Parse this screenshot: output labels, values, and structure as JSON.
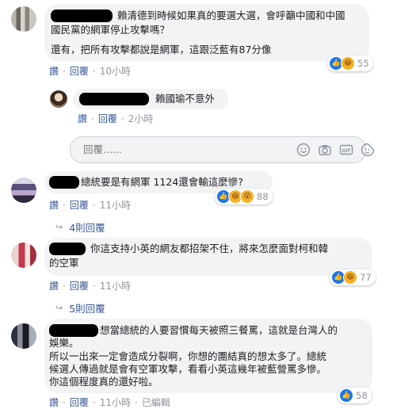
{
  "comments": [
    {
      "lines": [
        "賴清德到時候如果真的要選大選，會呼籲中國和中國",
        "國民黨的網軍停止攻擊嗎？",
        "",
        "還有，把所有攻擊都說是網軍，這跟泛藍有87分像"
      ],
      "like_label": "讚",
      "reply_label": "回覆",
      "time": "10小時",
      "reaction_count": "55"
    },
    {
      "reply_text": "賴國瑜不意外",
      "like_label": "讚",
      "reply_label": "回覆",
      "time": "2小時"
    },
    {
      "lines": [
        "總統要是有網軍 1124還會輸這麼慘?"
      ],
      "like_label": "讚",
      "reply_label": "回覆",
      "time": "11小時",
      "reaction_count": "88",
      "more_replies": "4則回覆"
    },
    {
      "lines": [
        "你這支持小英的網友都招架不住，將來怎麼面對柯和韓",
        "的空軍"
      ],
      "like_label": "讚",
      "reply_label": "回覆",
      "time": "11小時",
      "reaction_count": "77",
      "more_replies": "5則回覆"
    },
    {
      "lines": [
        "想當總統的人要習慣每天被照三餐罵，這就是台灣人的",
        "娛樂。",
        "所以一出來一定會造成分裂啊，你想的團結真的想太多了。總統",
        "候選人傳過就是會有空軍攻擊，看看小英這幾年被藍營罵多慘。",
        "你這個程度真的還好啦。"
      ],
      "like_label": "讚",
      "reply_label": "回覆",
      "time": "11小時",
      "edited": "已編輯",
      "reaction_count": "58"
    }
  ],
  "reply_input": {
    "placeholder": "回覆......"
  },
  "icons": {
    "emoji": "emoji-icon",
    "camera": "camera-icon",
    "gif": "gif-icon",
    "sticker": "sticker-icon",
    "like": "like-reaction-icon",
    "haha": "haha-reaction-icon",
    "wow": "wow-reaction-icon",
    "more_replies": "reply-arrow-icon"
  },
  "colors": {
    "link": "#385898",
    "meta": "#90949c",
    "bubble": "#f2f3f5",
    "like_blue": "#1877f2",
    "haha_yellow": "#f7b125"
  }
}
